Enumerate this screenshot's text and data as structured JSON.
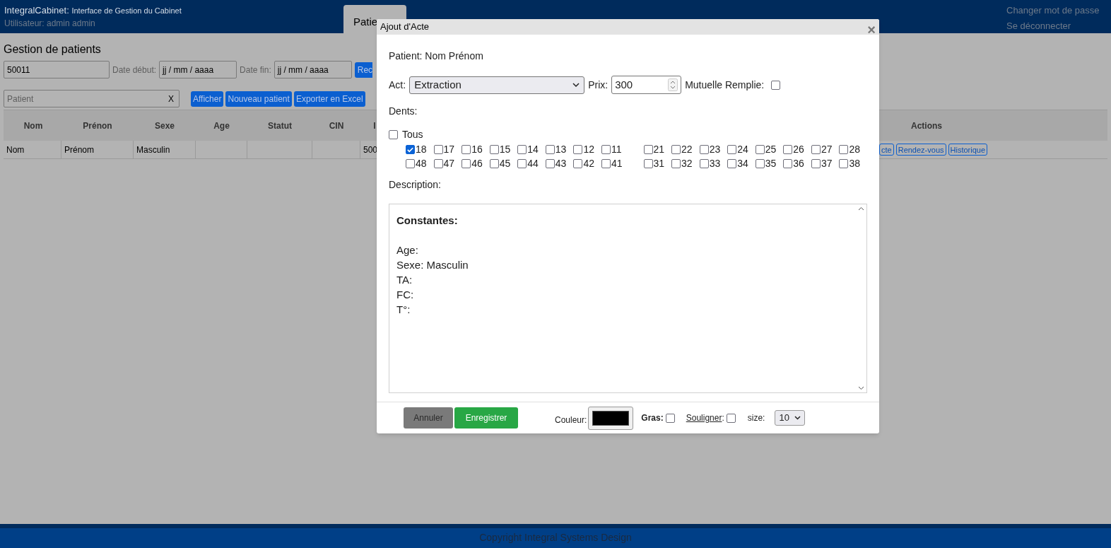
{
  "header": {
    "app_name": "IntegralCabinet:",
    "app_subtitle": "Interface de Gestion du Cabinet",
    "user": "Utilisateur: admin admin",
    "links": [
      "Changer mot de passe",
      "Se déconnecter"
    ]
  },
  "tabs": [
    {
      "label": "Patie",
      "selected": true
    }
  ],
  "page": {
    "title": "Gestion de patients",
    "id_field": "50011",
    "date_start_label": "Date début:",
    "date_start": "jj / mm / aaaa",
    "date_end_label": "Date fin:",
    "date_end": "jj / mm / aaaa",
    "search_button": "Rec",
    "patient_placeholder": "Patient",
    "clear": "X",
    "buttons": [
      "Afficher",
      "Nouveau patient",
      "Exporter en Excel"
    ]
  },
  "table": {
    "columns": [
      "Nom",
      "Prénon",
      "Sexe",
      "Age",
      "Statut",
      "CIN",
      "I"
    ],
    "actions_column": "Actions",
    "rows": [
      {
        "cells": [
          "Nom",
          "Prénom",
          "Masculin",
          "",
          "",
          "",
          "500"
        ],
        "actions": [
          "cte",
          "Rendez-vous",
          "Historique"
        ]
      }
    ]
  },
  "dialog": {
    "title": "Ajout d'Acte",
    "close": "×",
    "patient": "Patient: Nom Prénom",
    "act_label": "Act:",
    "act": "Extraction",
    "price_label": "Prix:",
    "price": "300",
    "mutuelle_label": "Mutuelle Remplie:",
    "mutuelle_checked": false,
    "teeth_label": "Dents:",
    "all_label": "Tous",
    "all_checked": false,
    "teeth_rows": [
      [
        {
          "n": "18",
          "checked": true
        },
        {
          "n": "17",
          "checked": false
        },
        {
          "n": "16",
          "checked": false
        },
        {
          "n": "15",
          "checked": false
        },
        {
          "n": "14",
          "checked": false
        },
        {
          "n": "13",
          "checked": false
        },
        {
          "n": "12",
          "checked": false
        },
        {
          "n": "11",
          "checked": false
        },
        {
          "n": "21",
          "checked": false
        },
        {
          "n": "22",
          "checked": false
        },
        {
          "n": "23",
          "checked": false
        },
        {
          "n": "24",
          "checked": false
        },
        {
          "n": "25",
          "checked": false
        },
        {
          "n": "26",
          "checked": false
        },
        {
          "n": "27",
          "checked": false
        },
        {
          "n": "28",
          "checked": false
        }
      ],
      [
        {
          "n": "48",
          "checked": false
        },
        {
          "n": "47",
          "checked": false
        },
        {
          "n": "46",
          "checked": false
        },
        {
          "n": "45",
          "checked": false
        },
        {
          "n": "44",
          "checked": false
        },
        {
          "n": "43",
          "checked": false
        },
        {
          "n": "42",
          "checked": false
        },
        {
          "n": "41",
          "checked": false
        },
        {
          "n": "31",
          "checked": false
        },
        {
          "n": "32",
          "checked": false
        },
        {
          "n": "33",
          "checked": false
        },
        {
          "n": "34",
          "checked": false
        },
        {
          "n": "35",
          "checked": false
        },
        {
          "n": "36",
          "checked": false
        },
        {
          "n": "37",
          "checked": false
        },
        {
          "n": "38",
          "checked": false
        }
      ]
    ],
    "description_label": "Description:",
    "description_heading": "Constantes:",
    "description_lines": [
      "Age:",
      "Sexe: Masculin",
      "TA:",
      "FC:",
      "T°:"
    ],
    "cancel": "Annuler",
    "save": "Enregistrer",
    "color_label": "Couleur:",
    "color": "#000000",
    "bold_label": "Gras:",
    "bold_checked": false,
    "underline_label": "Souligner",
    "underline_suffix": ":",
    "underline_checked": false,
    "size_label": "size:",
    "size": "10"
  },
  "footer": "Copyright Integral Systems Design"
}
